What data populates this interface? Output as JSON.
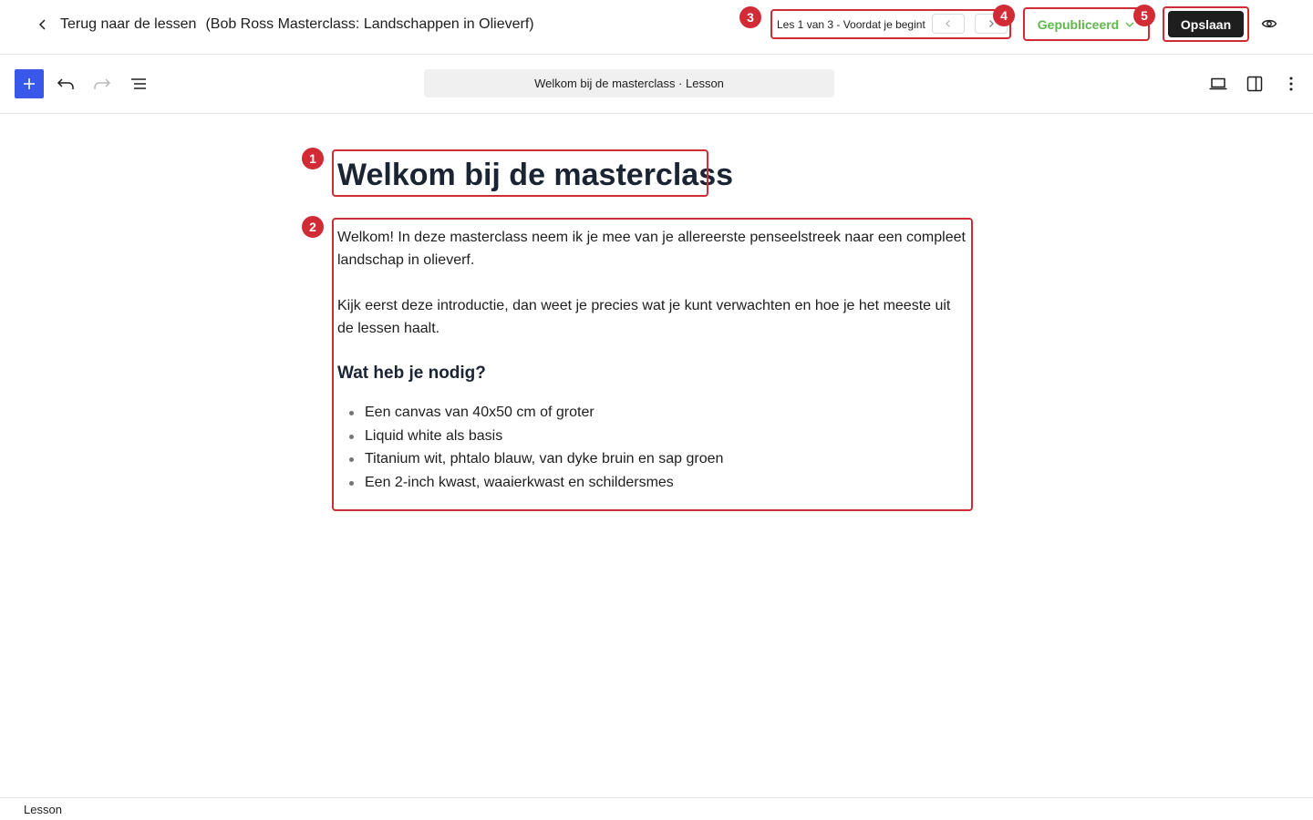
{
  "header": {
    "back_label": "Terug naar de lessen",
    "course_title": "(Bob Ross Masterclass: Landschappen in Olieverf)",
    "lesson_nav_label": "Les 1 van 3 - Voordat je begint",
    "status_label": "Gepubliceerd",
    "save_label": "Opslaan"
  },
  "toolbar": {
    "document_bar_label": "Welkom bij de masterclass · Lesson"
  },
  "content": {
    "title": "Welkom bij de masterclass",
    "paragraphs": [
      "Welkom! In deze masterclass neem ik je mee van je allereerste penseelstreek naar een compleet landschap in olieverf.",
      "Kijk eerst deze introductie, dan weet je precies wat je kunt verwachten en hoe je het meeste uit de lessen haalt."
    ],
    "subheading": "Wat heb je nodig?",
    "list_items": [
      "Een canvas van 40x50 cm of groter",
      "Liquid white als basis",
      "Titanium wit, phtalo blauw, van dyke bruin en sap groen",
      "Een 2-inch kwast, waaierkwast en schildersmes"
    ]
  },
  "annotations": [
    "1",
    "2",
    "3",
    "4",
    "5"
  ],
  "footer": {
    "breadcrumb_label": "Lesson"
  },
  "colors": {
    "accent": "#3858e9",
    "annotation": "#d12b35",
    "published": "#5fb94a",
    "save_button": "#1e1e1e"
  },
  "icons": [
    "chevron-left-icon",
    "chevron-right-icon",
    "chevron-down-icon",
    "eye-icon",
    "plus-icon",
    "undo-icon",
    "redo-icon",
    "list-view-icon",
    "desktop-preview-icon",
    "sidebar-toggle-icon",
    "more-options-icon"
  ]
}
